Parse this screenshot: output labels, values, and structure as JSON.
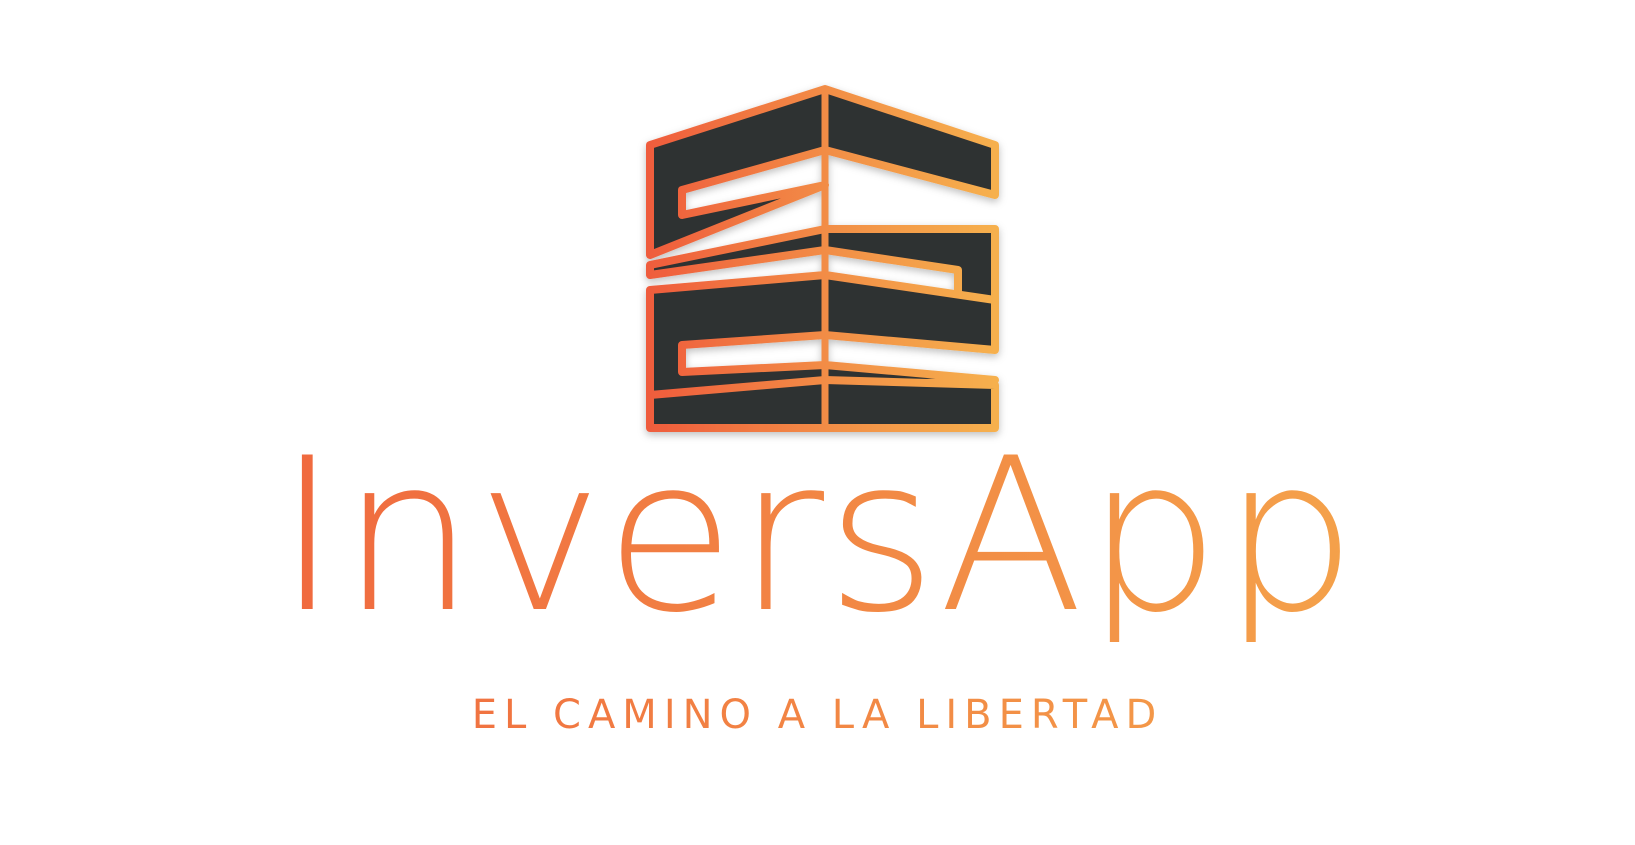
{
  "brand": {
    "name": "InversApp",
    "tagline": "EL CAMINO A LA LIBERTAD"
  },
  "logo": {
    "icon": "building-s-icon",
    "fill_color": "#2f3033",
    "gradient_start": "#ef5a3c",
    "gradient_end": "#f6b04e"
  }
}
